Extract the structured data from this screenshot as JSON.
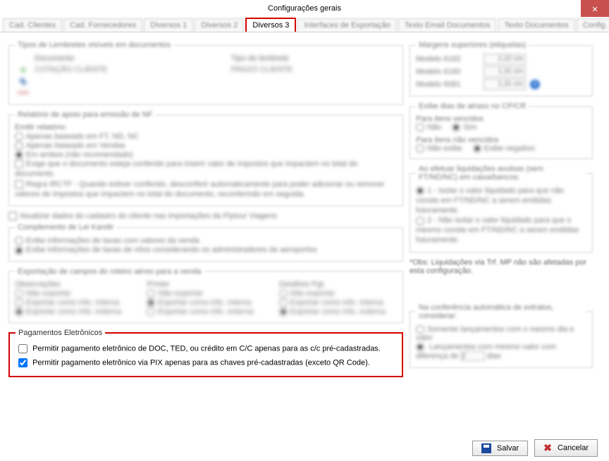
{
  "window": {
    "title": "Configurações gerais"
  },
  "tabs": {
    "items": [
      "Cad. Clientes",
      "Cad. Fornecedores",
      "Diversos 1",
      "Diversos 2",
      "Diversos 3",
      "Interfaces de Exportação",
      "Texto Email Documentos",
      "Texto Documentos",
      "Config. de Vendas"
    ],
    "active_index": 4
  },
  "lembretes": {
    "legend": "Tipos de Lembretes visíveis em documentos",
    "cols": {
      "doc": "Documento",
      "tipo": "Tipo de lembrete"
    },
    "rows": [
      {
        "doc": "COTAÇÃO CLIENTE",
        "tipo": "PRAZO CLIENTE"
      }
    ]
  },
  "relatorio_nf": {
    "legend": "Relatório de apoio para emissão de NF",
    "sub_legend": "Emitir relatório:",
    "opts": {
      "ft": "Apenas baseado em FT, ND, NC",
      "vendas": "Apenas baseado em Vendas",
      "ambos": "Em ambos (não recomendado)"
    },
    "chk_exige": "Exige que o documento esteja conferido para inserir valor de impostos que impactem no total do documento.",
    "chk_regra": "Regra IRCTF - Quando estiver conferido, desconferir automaticamente para poder adicionar ou remover valores de impostos que impactem no total do documento, reconferindo em seguida."
  },
  "atualizar_flytour": {
    "label": "Atualizar dados do cadastro do cliente nas importações da Flytour Viagens"
  },
  "leikandir": {
    "legend": "Complemento de Lei Kandir",
    "opt1": "Exibe informações de taxas com valores da venda",
    "opt2": "Exibe informações de taxas de vôos considerando os administradores de aeroportos"
  },
  "export_roteiro": {
    "legend": "Exportação de campos do roteiro aéreo para a venda",
    "groups": {
      "obs": {
        "label": "Observações",
        "o1": "Não exportar",
        "o2": "Exportar como info. interna",
        "o3": "Exportar como info. externa"
      },
      "printer": {
        "label": "Printer",
        "o1": "Não exportar",
        "o2": "Exportar como info. interna",
        "o3": "Exportar como info. externa"
      },
      "det": {
        "label": "Detalhes Pgt.",
        "o1": "Não exportar",
        "o2": "Exportar como info. interna",
        "o3": "Exportar como info. externa"
      }
    }
  },
  "margens": {
    "legend": "Margens superiores (etiquetas)",
    "rows": [
      {
        "label": "Modelo 6182",
        "val": "2,22 cm"
      },
      {
        "label": "Modelo 6180",
        "val": "1,31 cm"
      },
      {
        "label": "Modelo 6081",
        "val": "1,31 cm"
      }
    ]
  },
  "dias_atraso": {
    "legend": "Exibe dias de atraso no CP/CR",
    "g1": {
      "label": "Para itens vencidos",
      "nao": "Não",
      "sim": "Sim"
    },
    "g2": {
      "label": "Para itens não vencidos",
      "nao": "Não exibe",
      "neg": "Exibe negativo"
    }
  },
  "liquidacoes": {
    "legend": "Ao efetuar liquidações avulsas (sem FT/ND/NC) em caixa/bancos:",
    "o1": "1 - Isolar o valor liquidado para que não conste em FT/ND/NC a serem emitidas futuramente.",
    "o2": "2 - Não isolar o valor liquidado para que o mesmo conste em FT/ND/NC a serem emitidas futuramente.",
    "note": "*Obs: Liquidações via Trf. MP não são afetadas por esta configuração."
  },
  "conferencia": {
    "legend": "Na conferência automática de extratos, considerar:",
    "o1": "Somente lançamentos com o mesmo dia e valor",
    "o2_pre": "Lançamentos com mesmo valor com diferença de",
    "o2_val": "2",
    "o2_suf": "dias"
  },
  "pagamentos": {
    "legend": "Pagamentos Eletrônicos",
    "chk1": "Permitir pagamento eletrônico de DOC, TED, ou crédito em C/C apenas para as c/c pré-cadastradas.",
    "chk2": "Permitir pagamento eletrônico via PIX apenas para as chaves pré-cadastradas (exceto QR Code)."
  },
  "buttons": {
    "save": "Salvar",
    "cancel": "Cancelar"
  }
}
